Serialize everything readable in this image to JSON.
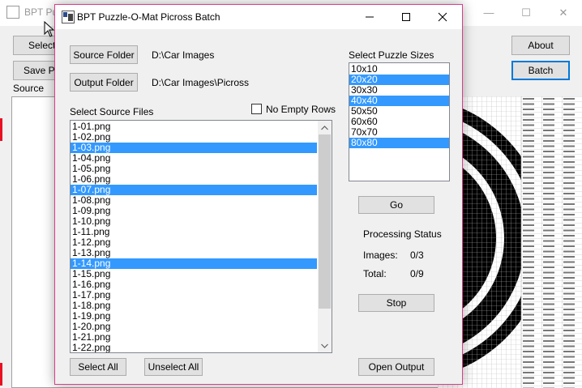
{
  "background_window": {
    "title": "BPT Pu",
    "buttons": {
      "select": "Select",
      "save": "Save P",
      "about": "About",
      "batch": "Batch"
    },
    "source_label": "Source",
    "controls": {
      "minimize": "—",
      "maximize": "☐",
      "close": "✕"
    }
  },
  "dialog": {
    "title": "BPT Puzzle-O-Mat Picross Batch",
    "source_folder_button": "Source Folder",
    "source_folder_path": "D:\\Car Images",
    "output_folder_button": "Output Folder",
    "output_folder_path": "D:\\Car Images\\Picross",
    "select_source_files_label": "Select Source Files",
    "no_empty_rows_label": "No Empty Rows",
    "no_empty_rows_checked": false,
    "files": [
      {
        "name": "1-01.png",
        "selected": false
      },
      {
        "name": "1-02.png",
        "selected": false
      },
      {
        "name": "1-03.png",
        "selected": true
      },
      {
        "name": "1-04.png",
        "selected": false
      },
      {
        "name": "1-05.png",
        "selected": false
      },
      {
        "name": "1-06.png",
        "selected": false
      },
      {
        "name": "1-07.png",
        "selected": true
      },
      {
        "name": "1-08.png",
        "selected": false
      },
      {
        "name": "1-09.png",
        "selected": false
      },
      {
        "name": "1-10.png",
        "selected": false
      },
      {
        "name": "1-11.png",
        "selected": false
      },
      {
        "name": "1-12.png",
        "selected": false
      },
      {
        "name": "1-13.png",
        "selected": false
      },
      {
        "name": "1-14.png",
        "selected": true
      },
      {
        "name": "1-15.png",
        "selected": false
      },
      {
        "name": "1-16.png",
        "selected": false
      },
      {
        "name": "1-17.png",
        "selected": false
      },
      {
        "name": "1-18.png",
        "selected": false
      },
      {
        "name": "1-19.png",
        "selected": false
      },
      {
        "name": "1-20.png",
        "selected": false
      },
      {
        "name": "1-21.png",
        "selected": false
      },
      {
        "name": "1-22.png",
        "selected": false
      }
    ],
    "select_puzzle_sizes_label": "Select Puzzle Sizes",
    "sizes": [
      {
        "name": "10x10",
        "selected": false
      },
      {
        "name": "20x20",
        "selected": true
      },
      {
        "name": "30x30",
        "selected": false
      },
      {
        "name": "40x40",
        "selected": true
      },
      {
        "name": "50x50",
        "selected": false
      },
      {
        "name": "60x60",
        "selected": false
      },
      {
        "name": "70x70",
        "selected": false
      },
      {
        "name": "80x80",
        "selected": true
      }
    ],
    "go_button": "Go",
    "processing_status_label": "Processing Status",
    "images_label": "Images:",
    "images_value": "0/3",
    "total_label": "Total:",
    "total_value": "0/9",
    "stop_button": "Stop",
    "select_all_button": "Select All",
    "unselect_all_button": "Unselect All",
    "open_output_button": "Open Output",
    "selection_color": "#3399ff",
    "border_accent": "#d63f8a"
  }
}
